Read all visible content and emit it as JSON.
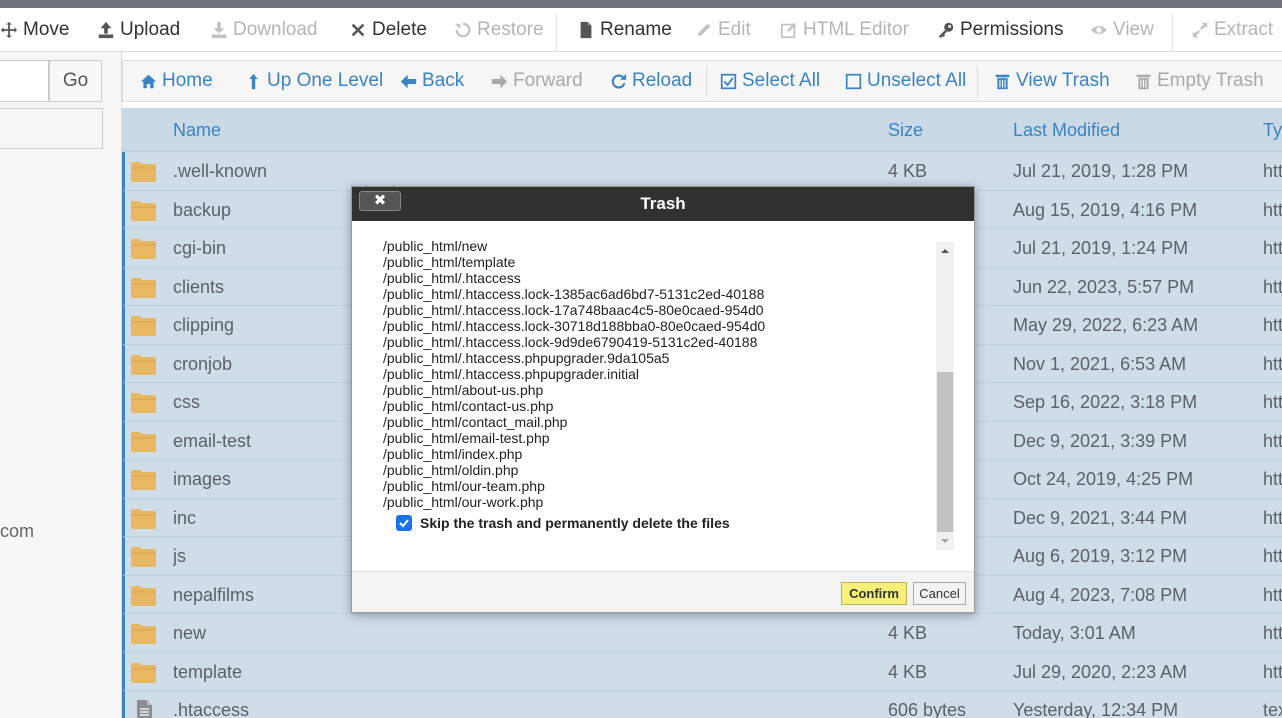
{
  "toolbar": {
    "move": "Move",
    "upload": "Upload",
    "download": "Download",
    "delete": "Delete",
    "restore": "Restore",
    "rename": "Rename",
    "edit": "Edit",
    "html_editor": "HTML Editor",
    "permissions": "Permissions",
    "view": "View",
    "extract": "Extract"
  },
  "left_panel": {
    "go_label": "Go",
    "domain_fragment": "com"
  },
  "nav": {
    "home": "Home",
    "up_one_level": "Up One Level",
    "back": "Back",
    "forward": "Forward",
    "reload": "Reload",
    "select_all": "Select All",
    "unselect_all": "Unselect All",
    "view_trash": "View Trash",
    "empty_trash": "Empty Trash"
  },
  "table": {
    "headers": {
      "name": "Name",
      "size": "Size",
      "modified": "Last Modified",
      "type": "Ty"
    },
    "rows": [
      {
        "name": ".well-known",
        "size": "4 KB",
        "modified": "Jul 21, 2019, 1:28 PM",
        "type": "htt",
        "icon": "folder-icon"
      },
      {
        "name": "backup",
        "size": "",
        "modified": "Aug 15, 2019, 4:16 PM",
        "type": "htt",
        "icon": "folder-icon"
      },
      {
        "name": "cgi-bin",
        "size": "",
        "modified": "Jul 21, 2019, 1:24 PM",
        "type": "htt",
        "icon": "folder-icon"
      },
      {
        "name": "clients",
        "size": "",
        "modified": "Jun 22, 2023, 5:57 PM",
        "type": "htt",
        "icon": "folder-icon"
      },
      {
        "name": "clipping",
        "size": "",
        "modified": "May 29, 2022, 6:23 AM",
        "type": "htt",
        "icon": "folder-icon"
      },
      {
        "name": "cronjob",
        "size": "",
        "modified": "Nov 1, 2021, 6:53 AM",
        "type": "htt",
        "icon": "folder-icon"
      },
      {
        "name": "css",
        "size": "",
        "modified": "Sep 16, 2022, 3:18 PM",
        "type": "htt",
        "icon": "folder-icon"
      },
      {
        "name": "email-test",
        "size": "",
        "modified": "Dec 9, 2021, 3:39 PM",
        "type": "htt",
        "icon": "folder-icon"
      },
      {
        "name": "images",
        "size": "",
        "modified": "Oct 24, 2019, 4:25 PM",
        "type": "htt",
        "icon": "folder-icon"
      },
      {
        "name": "inc",
        "size": "",
        "modified": "Dec 9, 2021, 3:44 PM",
        "type": "htt",
        "icon": "folder-icon"
      },
      {
        "name": "js",
        "size": "",
        "modified": "Aug 6, 2019, 3:12 PM",
        "type": "htt",
        "icon": "folder-icon"
      },
      {
        "name": "nepalfilms",
        "size": "",
        "modified": "Aug 4, 2023, 7:08 PM",
        "type": "htt",
        "icon": "folder-icon"
      },
      {
        "name": "new",
        "size": "4 KB",
        "modified": "Today, 3:01 AM",
        "type": "htt",
        "icon": "folder-icon"
      },
      {
        "name": "template",
        "size": "4 KB",
        "modified": "Jul 29, 2020, 2:23 AM",
        "type": "htt",
        "icon": "folder-icon"
      },
      {
        "name": ".htaccess",
        "size": "606 bytes",
        "modified": "Yesterday, 12:34 PM",
        "type": "tex",
        "icon": "file-icon"
      }
    ]
  },
  "modal": {
    "title": "Trash",
    "close_label": "✖",
    "files": [
      "/public_html/new",
      "/public_html/template",
      "/public_html/.htaccess",
      "/public_html/.htaccess.lock-1385ac6ad6bd7-5131c2ed-40188",
      "/public_html/.htaccess.lock-17a748baac4c5-80e0caed-954d0",
      "/public_html/.htaccess.lock-30718d188bba0-80e0caed-954d0",
      "/public_html/.htaccess.lock-9d9de6790419-5131c2ed-40188",
      "/public_html/.htaccess.phpupgrader.9da105a5",
      "/public_html/.htaccess.phpupgrader.initial",
      "/public_html/about-us.php",
      "/public_html/contact-us.php",
      "/public_html/contact_mail.php",
      "/public_html/email-test.php",
      "/public_html/index.php",
      "/public_html/oldin.php",
      "/public_html/our-team.php",
      "/public_html/our-work.php"
    ],
    "skip_label": "Skip the trash and permanently delete the files",
    "skip_checked": true,
    "confirm_label": "Confirm",
    "cancel_label": "Cancel"
  },
  "colors": {
    "accent": "#3a83c4",
    "selected_row": "#cfdde7",
    "modal_header": "#313131",
    "confirm_button": "#f6f07a"
  }
}
